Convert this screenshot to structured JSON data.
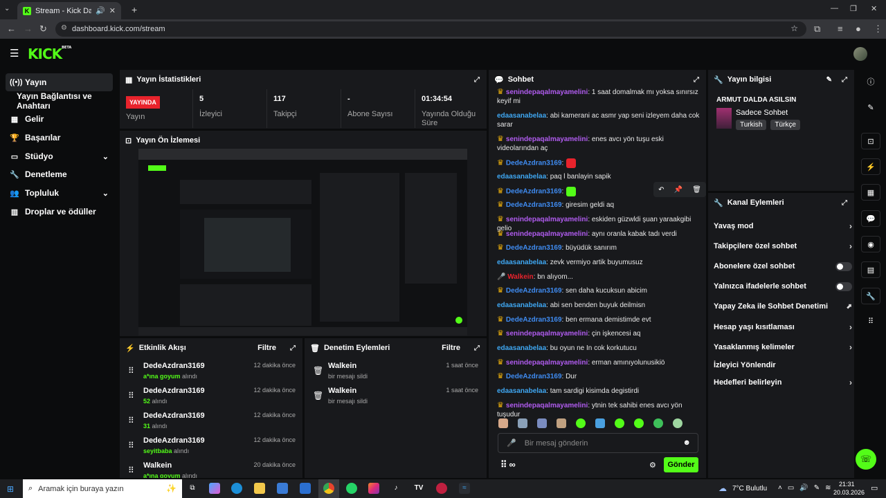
{
  "browser": {
    "tab_title": "Stream - Kick Dashboard",
    "url": "dashboard.kick.com/stream"
  },
  "header": {
    "logo": "KICK",
    "logo_sup": "BETA"
  },
  "sidebar": {
    "items": [
      {
        "label": "Yayın",
        "icon": "broadcast-icon"
      },
      {
        "label": "Yayın Bağlantısı ve Anahtarı",
        "icon": ""
      },
      {
        "label": "Gelir",
        "icon": "revenue-icon"
      },
      {
        "label": "Başarılar",
        "icon": "trophy-icon"
      },
      {
        "label": "Stüdyo",
        "icon": "studio-icon"
      },
      {
        "label": "Denetleme",
        "icon": "wrench-icon"
      },
      {
        "label": "Topluluk",
        "icon": "community-icon"
      },
      {
        "label": "Droplar ve ödüller",
        "icon": "gift-icon"
      }
    ]
  },
  "stats": {
    "title": "Yayın İstatistikleri",
    "live_badge": "YAYINDA",
    "live_label": "Yayın",
    "viewers_value": "5",
    "viewers_label": "İzleyici",
    "followers_value": "117",
    "followers_label": "Takipçi",
    "subs_value": "-",
    "subs_label": "Abone Sayısı",
    "uptime_value": "01:34:54",
    "uptime_label": "Yayında Olduğu Süre"
  },
  "preview": {
    "title": "Yayın Ön İzlemesi"
  },
  "activity": {
    "title": "Etkinlik Akışı",
    "filter": "Filtre",
    "rows": [
      {
        "name": "DedeAzdran3169",
        "highlight": "a*ına goyum",
        "suffix": "alındı",
        "time": "12 dakika önce"
      },
      {
        "name": "DedeAzdran3169",
        "highlight": "52",
        "suffix": "alındı",
        "time": "12 dakika önce"
      },
      {
        "name": "DedeAzdran3169",
        "highlight": "31",
        "suffix": "alındı",
        "time": "12 dakika önce"
      },
      {
        "name": "DedeAzdran3169",
        "highlight": "seyitbaba",
        "suffix": "alındı",
        "time": "12 dakika önce"
      },
      {
        "name": "Walkein",
        "highlight": "a*ına goyum",
        "suffix": "alındı",
        "time": "20 dakika önce"
      }
    ]
  },
  "moderation": {
    "title": "Denetim Eylemleri",
    "filter": "Filtre",
    "rows": [
      {
        "name": "Walkein",
        "sub": "bir mesajı sildi",
        "time": "1 saat önce"
      },
      {
        "name": "Walkein",
        "sub": "bir mesajı sildi",
        "time": "1 saat önce"
      }
    ]
  },
  "chat": {
    "title": "Sohbet",
    "messages": [
      {
        "user": "senindepaqalmayamelini",
        "color": "#b15cf0",
        "crown": true,
        "text": ": 1 saat domalmak mı yoksa sınırsız keyif mi"
      },
      {
        "user": "edaasanabelaa",
        "color": "#3fa7f2",
        "crown": false,
        "text": ": abi kamerani ac asmr yap seni izleyem daha cok sarar"
      },
      {
        "user": "senindepaqalmayamelini",
        "color": "#b15cf0",
        "crown": true,
        "text": ": enes avcı yön tuşu eski videolarından aç"
      },
      {
        "user": "DedeAzdran3169",
        "color": "#3f8cf2",
        "crown": true,
        "text": ":"
      },
      {
        "user": "edaasanabelaa",
        "color": "#3fa7f2",
        "crown": false,
        "text": ": paq l banlayin sapik"
      },
      {
        "user": "DedeAzdran3169",
        "color": "#3f8cf2",
        "crown": true,
        "text": ":"
      },
      {
        "user": "DedeAzdran3169",
        "color": "#3f8cf2",
        "crown": true,
        "text": ": giresim geldi aq"
      },
      {
        "user": "senindepaqalmayamelini",
        "color": "#b15cf0",
        "crown": true,
        "text": ": eskiden güzwldi şuan yaraakgibi gelio"
      },
      {
        "user": "senindepaqalmayamelini",
        "color": "#b15cf0",
        "crown": true,
        "text": ": aynı oranla kabak tadı verdi"
      },
      {
        "user": "DedeAzdran3169",
        "color": "#3f8cf2",
        "crown": true,
        "text": ": büyüdük sanırım"
      },
      {
        "user": "edaasanabelaa",
        "color": "#3fa7f2",
        "crown": false,
        "text": ": zevk vermiyo artik buyumusuz"
      },
      {
        "user": "Walkein",
        "color": "#e8232c",
        "crown": false,
        "mic": true,
        "text": ": bn alıyom..."
      },
      {
        "user": "DedeAzdran3169",
        "color": "#3f8cf2",
        "crown": true,
        "text": ": sen daha kucuksun abicim"
      },
      {
        "user": "edaasanabelaa",
        "color": "#3fa7f2",
        "crown": false,
        "text": ": abi sen benden buyuk deilmisn"
      },
      {
        "user": "DedeAzdran3169",
        "color": "#3f8cf2",
        "crown": true,
        "text": ": ben ermana demistimde evt"
      },
      {
        "user": "senindepaqalmayamelini",
        "color": "#b15cf0",
        "crown": true,
        "text": ": çin işkencesi aq"
      },
      {
        "user": "edaasanabelaa",
        "color": "#3fa7f2",
        "crown": false,
        "text": ": bu oyun ne In cok korkutucu"
      },
      {
        "user": "senindepaqalmayamelini",
        "color": "#b15cf0",
        "crown": true,
        "text": ": erman amınıyolunusikiö"
      },
      {
        "user": "DedeAzdran3169",
        "color": "#3f8cf2",
        "crown": true,
        "text": ": Dur"
      },
      {
        "user": "edaasanabelaa",
        "color": "#3fa7f2",
        "crown": false,
        "text": ": tam sardigi kisimda degistirdi"
      },
      {
        "user": "senindepaqalmayamelini",
        "color": "#b15cf0",
        "crown": true,
        "text": ": ytnin tek sahibi enes avcı yön tuşudur"
      }
    ],
    "input_placeholder": "Bir mesaj gönderin",
    "send": "Gönder",
    "points": "∞"
  },
  "stream_info": {
    "title": "Yayın bilgisi",
    "stream_title": "ARMUT DALDA ASILSIN",
    "category": "Sadece Sohbet",
    "tags": [
      "Turkish",
      "Türkçe"
    ]
  },
  "channel_actions": {
    "title": "Kanal Eylemleri",
    "rows": [
      {
        "label": "Yavaş mod",
        "kind": "chevron"
      },
      {
        "label": "Takipçilere özel sohbet",
        "kind": "chevron"
      },
      {
        "label": "Abonelere özel sohbet",
        "kind": "toggle"
      },
      {
        "label": "Yalnızca ifadelerle sohbet",
        "kind": "toggle"
      },
      {
        "label": "Yapay Zeka ile Sohbet Denetimi",
        "kind": "external"
      },
      {
        "label": "Hesap yaşı kısıtlaması",
        "kind": "chevron"
      },
      {
        "label": "Yasaklanmış kelimeler",
        "kind": "chevron"
      },
      {
        "label": "İzleyici Yönlendir",
        "kind": "none"
      },
      {
        "label": "Hedefleri belirleyin",
        "kind": "chevron"
      }
    ]
  },
  "taskbar": {
    "search_placeholder": "Aramak için buraya yazın",
    "weather": "7°C  Bulutlu",
    "time": "21:31",
    "date": "20.03.2026"
  },
  "colors": {
    "accent": "#53fc18",
    "live": "#e8232c",
    "panel": "#18191c",
    "bg": "#0b0c0d"
  }
}
